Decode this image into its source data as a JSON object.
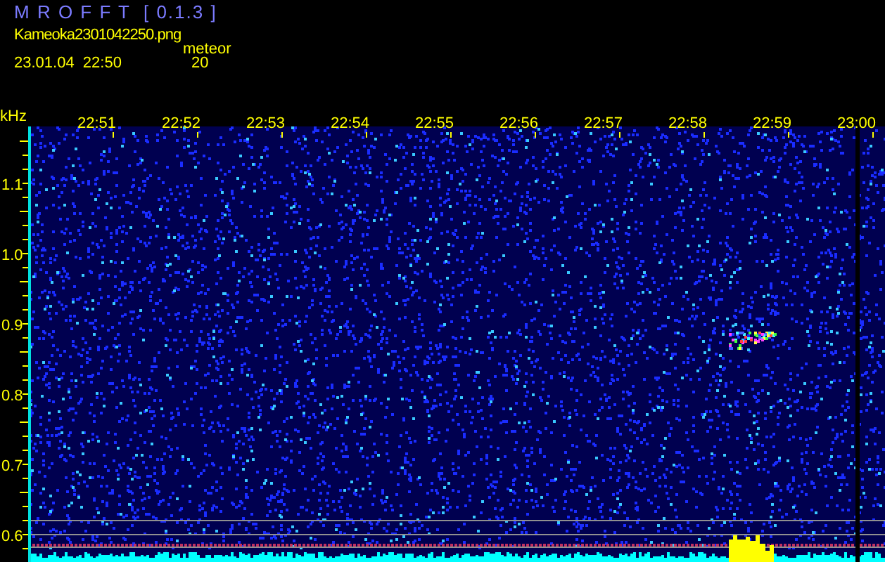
{
  "app_title": "M R O F F T  [ 0.1.3 ]",
  "file_name": "Kameoka2301042250.png",
  "detection_label": "meteor",
  "date_time": "23.01.04  22:50",
  "detection_count": "20",
  "y_axis": {
    "unit": "kHz",
    "labels": [
      "1.1",
      "1.0",
      "0.9",
      "0.8",
      "0.7",
      "0.6"
    ]
  },
  "x_axis": {
    "labels": [
      "22:51",
      "22:52",
      "22:53",
      "22:54",
      "22:55",
      "22:56",
      "22:57",
      "22:58",
      "22:59",
      "23:00"
    ]
  }
}
